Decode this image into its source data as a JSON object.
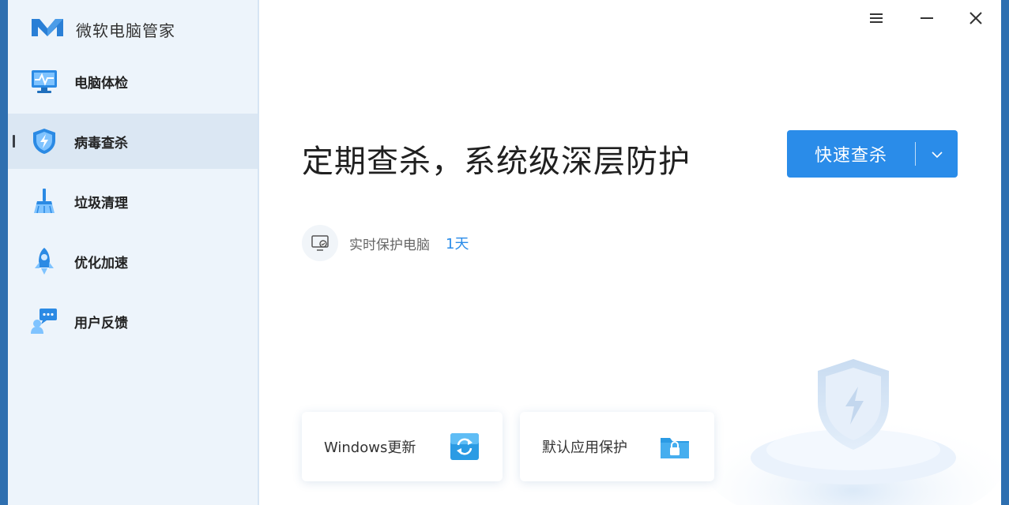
{
  "app": {
    "name": "微软电脑管家"
  },
  "sidebar": {
    "items": [
      {
        "label": "电脑体检",
        "icon": "monitor-checkup-icon"
      },
      {
        "label": "病毒查杀",
        "icon": "shield-lightning-icon",
        "active": true
      },
      {
        "label": "垃圾清理",
        "icon": "broom-icon"
      },
      {
        "label": "优化加速",
        "icon": "rocket-icon"
      },
      {
        "label": "用户反馈",
        "icon": "feedback-chat-icon"
      }
    ]
  },
  "window_controls": {
    "menu": "menu-icon",
    "minimize": "minimize-icon",
    "close": "close-icon"
  },
  "main": {
    "headline": "定期查杀，系统级深层防护",
    "scan_button": {
      "label": "快速查杀",
      "dropdown_icon": "chevron-down-icon"
    },
    "protection": {
      "label": "实时保护电脑",
      "days": "1天",
      "icon": "protected-pc-icon"
    },
    "cards": [
      {
        "label": "Windows更新",
        "icon": "windows-update-icon"
      },
      {
        "label": "默认应用保护",
        "icon": "lock-folder-icon"
      }
    ]
  },
  "colors": {
    "accent": "#2a8ce9",
    "sidebar_bg": "#edf4fb",
    "sidebar_active": "#dbe7f3",
    "frame": "#2e6fb0"
  }
}
